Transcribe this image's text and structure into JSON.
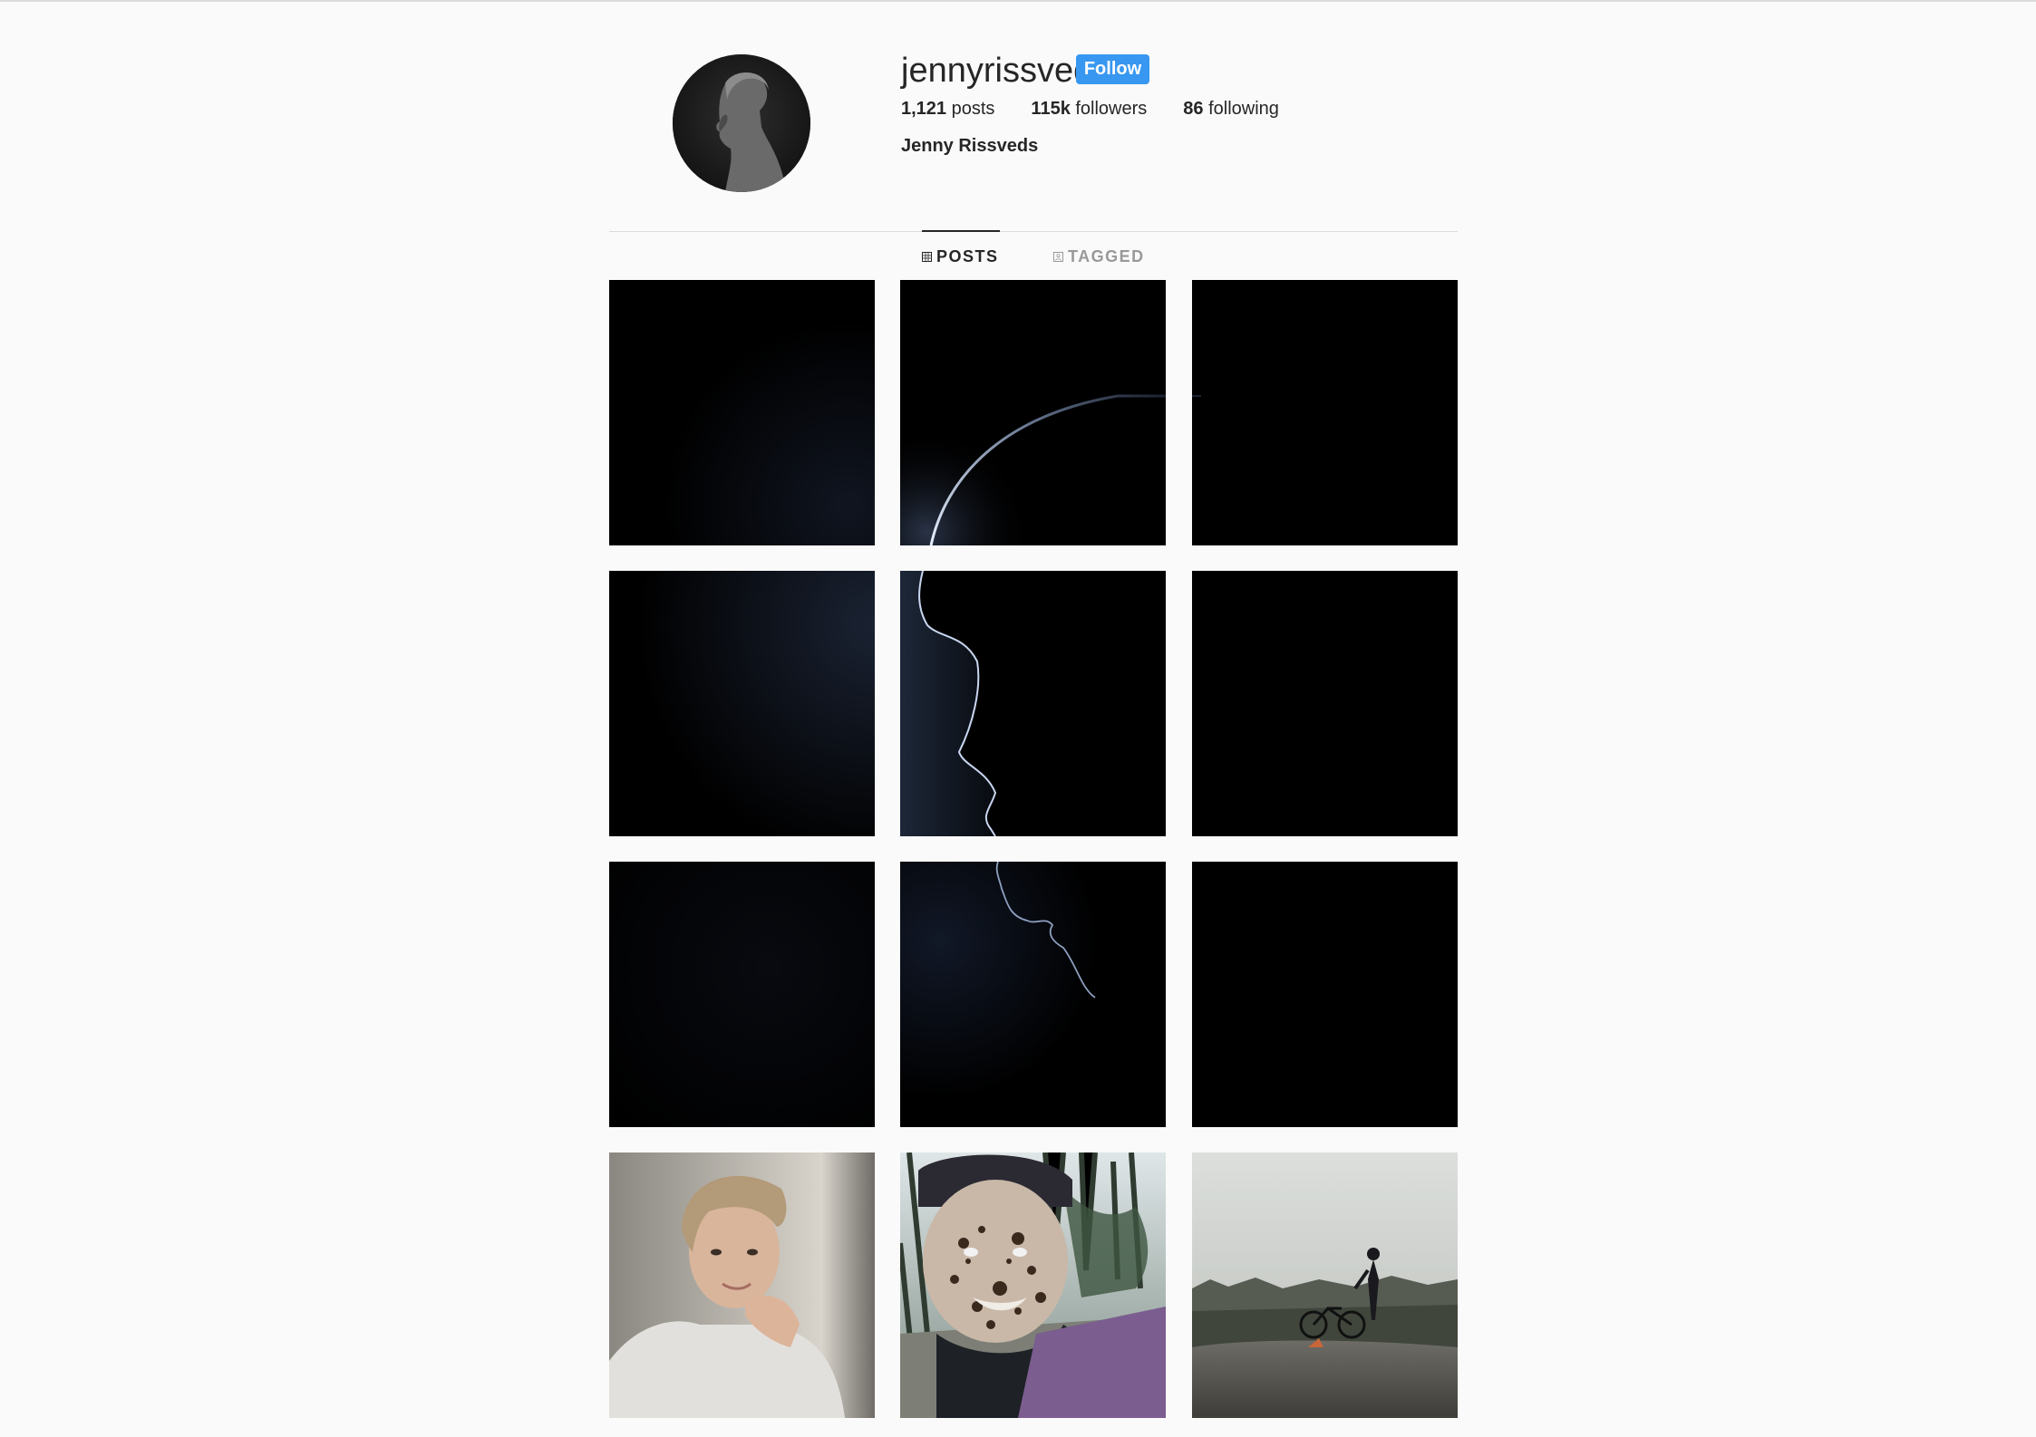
{
  "profile": {
    "username": "jennyrissveds",
    "follow_label": "Follow",
    "full_name": "Jenny Rissveds",
    "avatar_icon": "profile-photo",
    "accent_color": "#3897f0",
    "stats": {
      "posts_count": "1,121",
      "posts_label": " posts",
      "followers_count": "115k",
      "followers_label": " followers",
      "following_count": "86",
      "following_label": " following"
    }
  },
  "tabs": {
    "posts_label": "POSTS",
    "tagged_label": "TAGGED",
    "active": "posts",
    "posts_icon": "grid-icon",
    "tagged_icon": "tag-icon"
  },
  "posts": [
    {
      "image": "dark-gradient"
    },
    {
      "image": "dark-rim-arc"
    },
    {
      "image": "dark-gradient"
    },
    {
      "image": "dark-gradient"
    },
    {
      "image": "face-profile-silhouette"
    },
    {
      "image": "dark-gradient"
    },
    {
      "image": "dark-gradient"
    },
    {
      "image": "chin-silhouette"
    },
    {
      "image": "dark-gradient"
    },
    {
      "image": "portrait-sweater"
    },
    {
      "image": "muddy-helmet-selfie"
    },
    {
      "image": "cyclist-on-rock"
    }
  ]
}
